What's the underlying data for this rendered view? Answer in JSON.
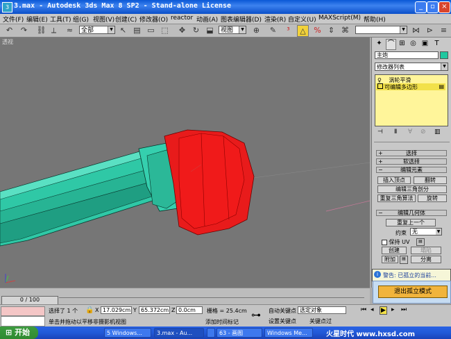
{
  "window": {
    "title": "3.max - Autodesk 3ds Max 8 SP2 - Stand-alone License",
    "app_icon": "3ds-max-icon"
  },
  "menu": [
    "文件(F)",
    "编辑(E)",
    "工具(T)",
    "组(G)",
    "视图(V)",
    "创建(C)",
    "修改器(O)",
    "reactor",
    "动画(A)",
    "图表编辑器(D)",
    "渲染(R)",
    "自定义(U)",
    "MAXScript(M)",
    "帮助(H)"
  ],
  "toolbar": {
    "selection_filter": "全部",
    "coord_system": "视图"
  },
  "viewport": {
    "label": "透视"
  },
  "command_panel": {
    "object_name": "主炮",
    "modifier_list": "修改器列表",
    "stack": [
      "涡轮平滑",
      "可编辑多边形"
    ],
    "rollouts": {
      "select": "选择",
      "soft_select": "软选择",
      "edit_elements": "编辑元素",
      "edit_geometry": "编辑几何体"
    },
    "buttons": {
      "insert_vertex": "插入顶点",
      "flip": "翻转",
      "edit_tri": "编辑三角剖分",
      "retri": "重复三角算法",
      "turn": "旋转",
      "repeat_last": "重复上一个",
      "constraint_label": "约束",
      "constraint_value": "无",
      "preserve_uv": "保持 UV",
      "create": "创建",
      "collapse": "塌陷",
      "attach": "附加",
      "detach": "分离"
    },
    "warning": "警告: 已孤立的当前...",
    "exit_isolation": "退出孤立模式",
    "colors": {
      "object_color": "#20c8a0",
      "highlight": "#f2e14a"
    }
  },
  "timeline": {
    "frame": "0 / 100"
  },
  "status": {
    "selected": "选择了 1 个",
    "prompt": "单击并拖动以平移非摄影机视图",
    "x": "17.029cm",
    "y": "65.372cm",
    "z": "0.0cm",
    "grid": "栅格 = 25.4cm",
    "auto_key": "自动关键点",
    "set_key": "设置关键点",
    "key_filter_selected": "选定对象",
    "key_filters": "关键点过",
    "add_time_tag": "添加时间标记"
  },
  "taskbar": {
    "start": "开始",
    "tasks": [
      "5 Windows...",
      "3.max - Au...",
      "",
      "63 - 画图",
      "Windows Me..."
    ],
    "watermark": "火星时代 www.hxsd.com"
  }
}
